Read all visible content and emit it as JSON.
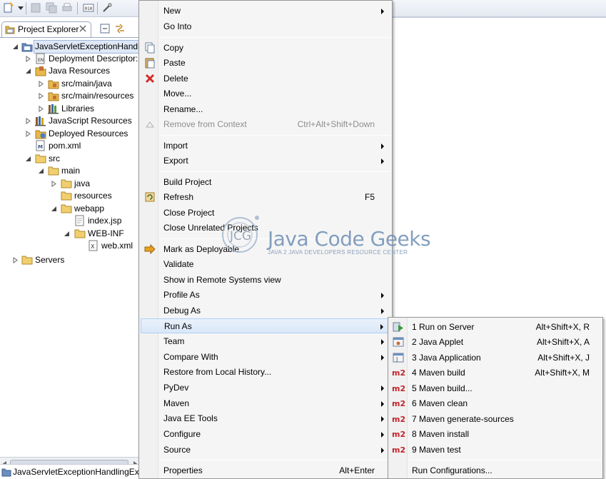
{
  "explorer": {
    "tab_label": "Project Explorer",
    "project_name": "JavaServletExceptionHandlin",
    "status_text": "JavaServletExceptionHandlingEx",
    "tree": [
      {
        "label": "JavaServletExceptionHandlin",
        "icon": "project-icon"
      },
      {
        "label": "Deployment Descriptor:",
        "icon": "descriptor-icon"
      },
      {
        "label": "Java Resources",
        "icon": "java-resources-icon"
      },
      {
        "label": "src/main/java",
        "icon": "package-folder-icon"
      },
      {
        "label": "src/main/resources",
        "icon": "package-folder-icon"
      },
      {
        "label": "Libraries",
        "icon": "library-icon"
      },
      {
        "label": "JavaScript Resources",
        "icon": "js-resources-icon"
      },
      {
        "label": "Deployed Resources",
        "icon": "deployed-icon"
      },
      {
        "label": "pom.xml",
        "icon": "maven-file-icon"
      },
      {
        "label": "src",
        "icon": "folder-icon"
      },
      {
        "label": "main",
        "icon": "folder-icon"
      },
      {
        "label": "java",
        "icon": "folder-icon"
      },
      {
        "label": "resources",
        "icon": "folder-icon"
      },
      {
        "label": "webapp",
        "icon": "folder-icon"
      },
      {
        "label": "index.jsp",
        "icon": "file-icon"
      },
      {
        "label": "WEB-INF",
        "icon": "folder-icon"
      },
      {
        "label": "web.xml",
        "icon": "xml-file-icon"
      },
      {
        "label": "Servers",
        "icon": "folder-icon"
      }
    ]
  },
  "context_menu": {
    "items": [
      {
        "label": "New",
        "submenu": true
      },
      {
        "label": "Go Into"
      },
      {
        "label": "Copy",
        "icon": "copy-icon"
      },
      {
        "label": "Paste",
        "icon": "paste-icon"
      },
      {
        "label": "Delete",
        "icon": "delete-icon"
      },
      {
        "label": "Move..."
      },
      {
        "label": "Rename..."
      },
      {
        "label": "Remove from Context",
        "shortcut": "Ctrl+Alt+Shift+Down",
        "disabled": true
      },
      {
        "label": "Import",
        "submenu": true
      },
      {
        "label": "Export",
        "submenu": true
      },
      {
        "label": "Build Project"
      },
      {
        "label": "Refresh",
        "shortcut": "F5",
        "icon": "refresh-icon"
      },
      {
        "label": "Close Project"
      },
      {
        "label": "Close Unrelated Projects"
      },
      {
        "label": "Mark as Deployable",
        "icon": "deploy-icon"
      },
      {
        "label": "Validate"
      },
      {
        "label": "Show in Remote Systems view"
      },
      {
        "label": "Profile As",
        "submenu": true
      },
      {
        "label": "Debug As",
        "submenu": true
      },
      {
        "label": "Run As",
        "submenu": true,
        "hover": true
      },
      {
        "label": "Team",
        "submenu": true
      },
      {
        "label": "Compare With",
        "submenu": true
      },
      {
        "label": "Restore from Local History..."
      },
      {
        "label": "PyDev",
        "submenu": true
      },
      {
        "label": "Maven",
        "submenu": true
      },
      {
        "label": "Java EE Tools",
        "submenu": true
      },
      {
        "label": "Configure",
        "submenu": true
      },
      {
        "label": "Source",
        "submenu": true
      },
      {
        "label": "Properties",
        "shortcut": "Alt+Enter"
      }
    ]
  },
  "run_as_menu": {
    "items": [
      {
        "label": "1 Run on Server",
        "shortcut": "Alt+Shift+X, R",
        "icon": "run-server-icon"
      },
      {
        "label": "2 Java Applet",
        "shortcut": "Alt+Shift+X, A",
        "icon": "applet-icon"
      },
      {
        "label": "3 Java Application",
        "shortcut": "Alt+Shift+X, J",
        "icon": "java-app-icon"
      },
      {
        "label": "4 Maven build",
        "shortcut": "Alt+Shift+X, M",
        "icon": "m2-icon"
      },
      {
        "label": "5 Maven build...",
        "icon": "m2-icon"
      },
      {
        "label": "6 Maven clean",
        "icon": "m2-icon"
      },
      {
        "label": "7 Maven generate-sources",
        "icon": "m2-icon"
      },
      {
        "label": "8 Maven install",
        "icon": "m2-icon"
      },
      {
        "label": "9 Maven test",
        "icon": "m2-icon"
      },
      {
        "label": "Run Configurations..."
      }
    ],
    "m2_text": "m2"
  },
  "watermark": {
    "title": "Java Code Geeks",
    "subtitle": "JAVA 2 JAVA DEVELOPERS RESOURCE CENTER",
    "logo_text": "JCG"
  },
  "colors": {
    "hover_bg": "#d9e7f8",
    "m2_red": "#c0252a",
    "folder_yellow": "#e8b84a"
  }
}
